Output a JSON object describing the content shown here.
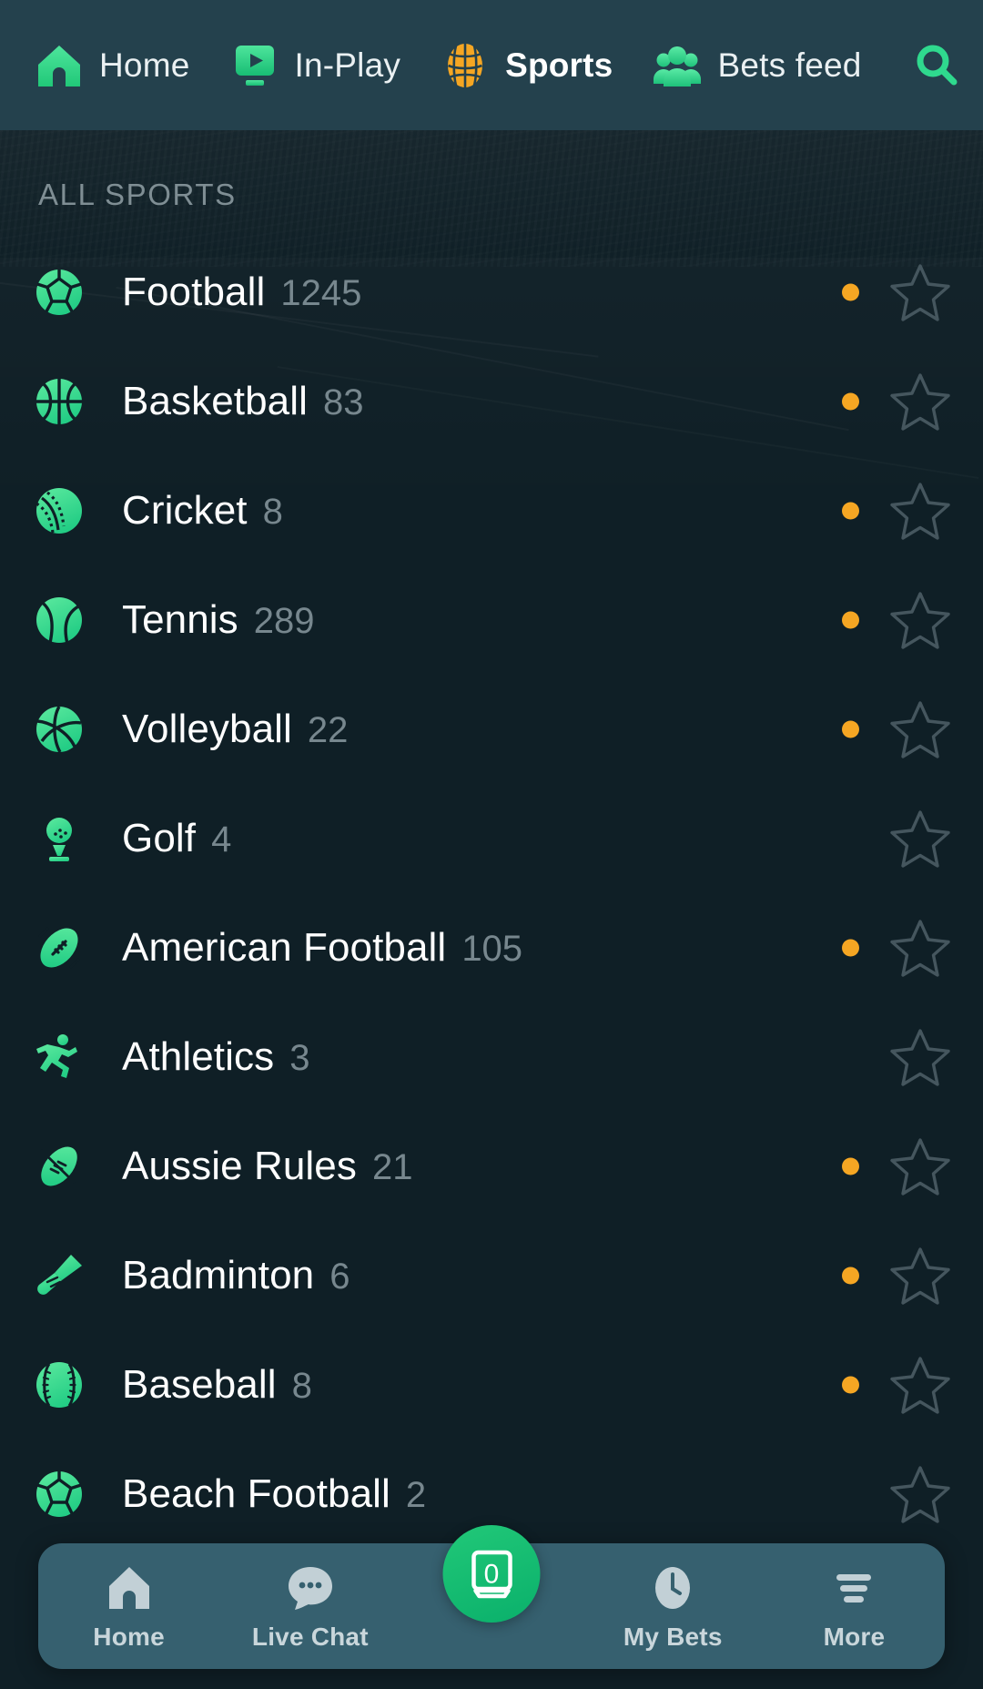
{
  "theme": {
    "page_bg": "#0f1f26",
    "header_bg": "#24414d",
    "bottom_nav_bg": "#36606f",
    "accent_green": "#3fdb93",
    "live_orange": "#f5a623",
    "brand_orange": "#f5a623",
    "text_primary": "#ffffff",
    "text_muted": "#77878e",
    "fab_green": "#12b874"
  },
  "top_nav": {
    "items": [
      {
        "label": "Home",
        "icon": "home-icon",
        "active": false
      },
      {
        "label": "In-Play",
        "icon": "in-play-icon",
        "active": false
      },
      {
        "label": "Sports",
        "icon": "sports-ball-icon",
        "active": true
      },
      {
        "label": "Bets feed",
        "icon": "bets-feed-icon",
        "active": false
      }
    ],
    "search_icon": "search-icon"
  },
  "main": {
    "section_title": "ALL SPORTS",
    "sports": [
      {
        "name": "Football",
        "count": "1245",
        "icon": "football-icon",
        "live": true,
        "favorite": false
      },
      {
        "name": "Basketball",
        "count": "83",
        "icon": "basketball-icon",
        "live": true,
        "favorite": false
      },
      {
        "name": "Cricket",
        "count": "8",
        "icon": "cricket-icon",
        "live": true,
        "favorite": false
      },
      {
        "name": "Tennis",
        "count": "289",
        "icon": "tennis-icon",
        "live": true,
        "favorite": false
      },
      {
        "name": "Volleyball",
        "count": "22",
        "icon": "volleyball-icon",
        "live": true,
        "favorite": false
      },
      {
        "name": "Golf",
        "count": "4",
        "icon": "golf-icon",
        "live": false,
        "favorite": false
      },
      {
        "name": "American Football",
        "count": "105",
        "icon": "american-football-icon",
        "live": true,
        "favorite": false
      },
      {
        "name": "Athletics",
        "count": "3",
        "icon": "athletics-icon",
        "live": false,
        "favorite": false
      },
      {
        "name": "Aussie Rules",
        "count": "21",
        "icon": "aussie-rules-icon",
        "live": true,
        "favorite": false
      },
      {
        "name": "Badminton",
        "count": "6",
        "icon": "badminton-icon",
        "live": true,
        "favorite": false
      },
      {
        "name": "Baseball",
        "count": "8",
        "icon": "baseball-icon",
        "live": true,
        "favorite": false
      },
      {
        "name": "Beach Football",
        "count": "2",
        "icon": "beach-football-icon",
        "live": false,
        "favorite": false
      }
    ]
  },
  "bottom_nav": {
    "items": [
      {
        "label": "Home",
        "icon": "home-icon"
      },
      {
        "label": "Live Chat",
        "icon": "chat-bubble-icon"
      },
      {
        "label": "My Bets",
        "icon": "clock-icon"
      },
      {
        "label": "More",
        "icon": "menu-lines-icon"
      }
    ],
    "betslip": {
      "icon": "betslip-icon",
      "count": "0"
    }
  }
}
